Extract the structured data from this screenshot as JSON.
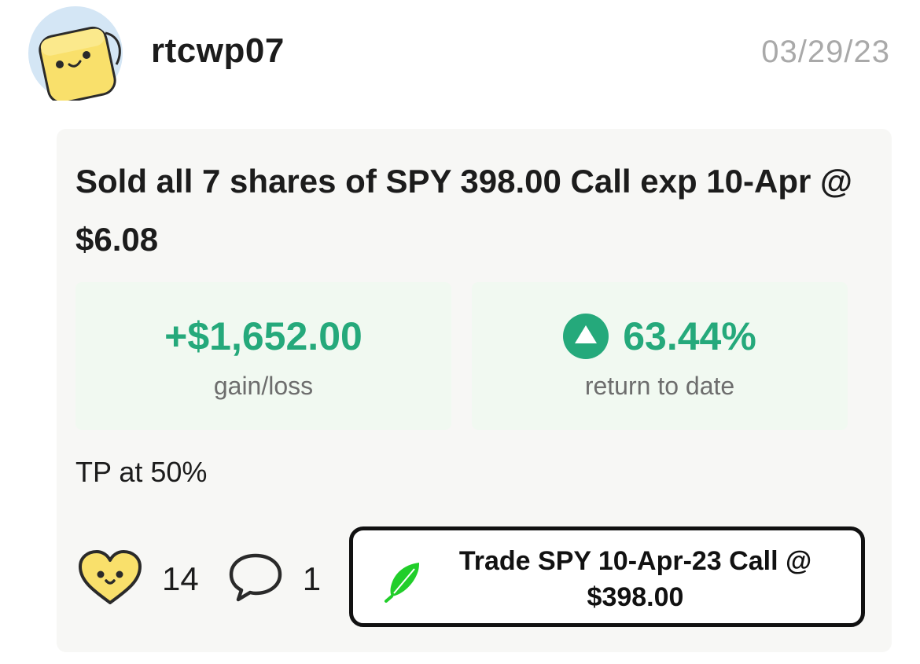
{
  "post": {
    "username": "rtcwp07",
    "date": "03/29/23",
    "avatar_icon": "yellow-smiley-block-icon"
  },
  "trade": {
    "title": "Sold all 7 shares of SPY 398.00 Call exp 10-Apr @ $6.08",
    "gain_value": "+$1,652.00",
    "gain_label": "gain/loss",
    "return_value": "63.44%",
    "return_label": "return to date",
    "return_icon": "up-arrow-circle-icon",
    "note": "TP at 50%"
  },
  "actions": {
    "like_icon": "heart-face-icon",
    "like_count": "14",
    "comment_icon": "speech-bubble-icon",
    "comment_count": "1",
    "trade_button_icon": "robinhood-feather-icon",
    "trade_button_label": "Trade SPY 10-Apr-23 Call @ $398.00"
  },
  "colors": {
    "accent_green": "#25a97b",
    "stat_background": "#f1f9f1",
    "card_background": "#f7f7f5",
    "avatar_yellow": "#f9e06b",
    "avatar_background": "#d4e6f5",
    "feather_green": "#21ce2a"
  }
}
